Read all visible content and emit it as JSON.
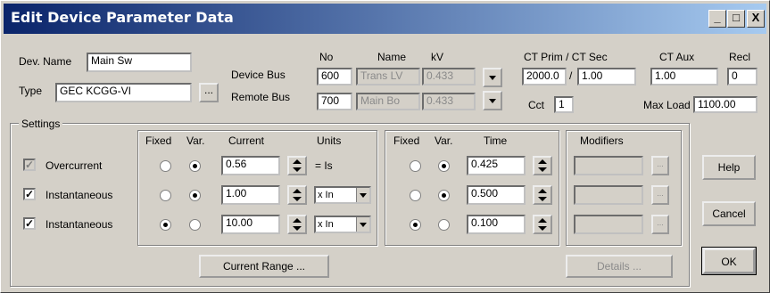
{
  "window": {
    "title": "Edit Device Parameter Data",
    "minimize": "_",
    "maximize": "□",
    "close": "X"
  },
  "device": {
    "name_label": "Dev. Name",
    "name_value": "Main Sw",
    "type_label": "Type",
    "type_value": "GEC KCGG-VI",
    "type_browse": "...",
    "device_bus_label": "Device Bus",
    "remote_bus_label": "Remote Bus",
    "col_no": "No",
    "col_name": "Name",
    "col_kv": "kV",
    "device_bus": {
      "no": "600",
      "name": "Trans LV",
      "kv": "0.433"
    },
    "remote_bus": {
      "no": "700",
      "name": "Main Bo",
      "kv": "0.433"
    }
  },
  "ct": {
    "prim_sec_label": "CT Prim / CT Sec",
    "aux_label": "CT Aux",
    "recl_label": "Recl",
    "prim": "2000.0",
    "sep": "/",
    "sec": "1.00",
    "aux": "1.00",
    "recl": "0",
    "cct_label": "Cct",
    "cct": "1",
    "maxload_label": "Max Load",
    "maxload": "1100.00"
  },
  "settings": {
    "group_label": "Settings",
    "current_headers": {
      "fixed": "Fixed",
      "var": "Var.",
      "current": "Current",
      "units": "Units"
    },
    "time_headers": {
      "fixed": "Fixed",
      "var": "Var.",
      "time": "Time"
    },
    "modifiers_label": "Modifiers",
    "rows": [
      {
        "label": "Overcurrent",
        "checked": "✓",
        "current": "0.56",
        "units": "= Is",
        "time": "0.425"
      },
      {
        "label": "Instantaneous",
        "checked": "✓",
        "current": "1.00",
        "units": "x In",
        "time": "0.500"
      },
      {
        "label": "Instantaneous",
        "checked": "✓",
        "current": "10.00",
        "units": "x In",
        "time": "0.100"
      }
    ],
    "ellipsis": "..."
  },
  "buttons": {
    "current_range": "Current Range ...",
    "details": "Details ...",
    "help": "Help",
    "cancel": "Cancel",
    "ok": "OK"
  }
}
